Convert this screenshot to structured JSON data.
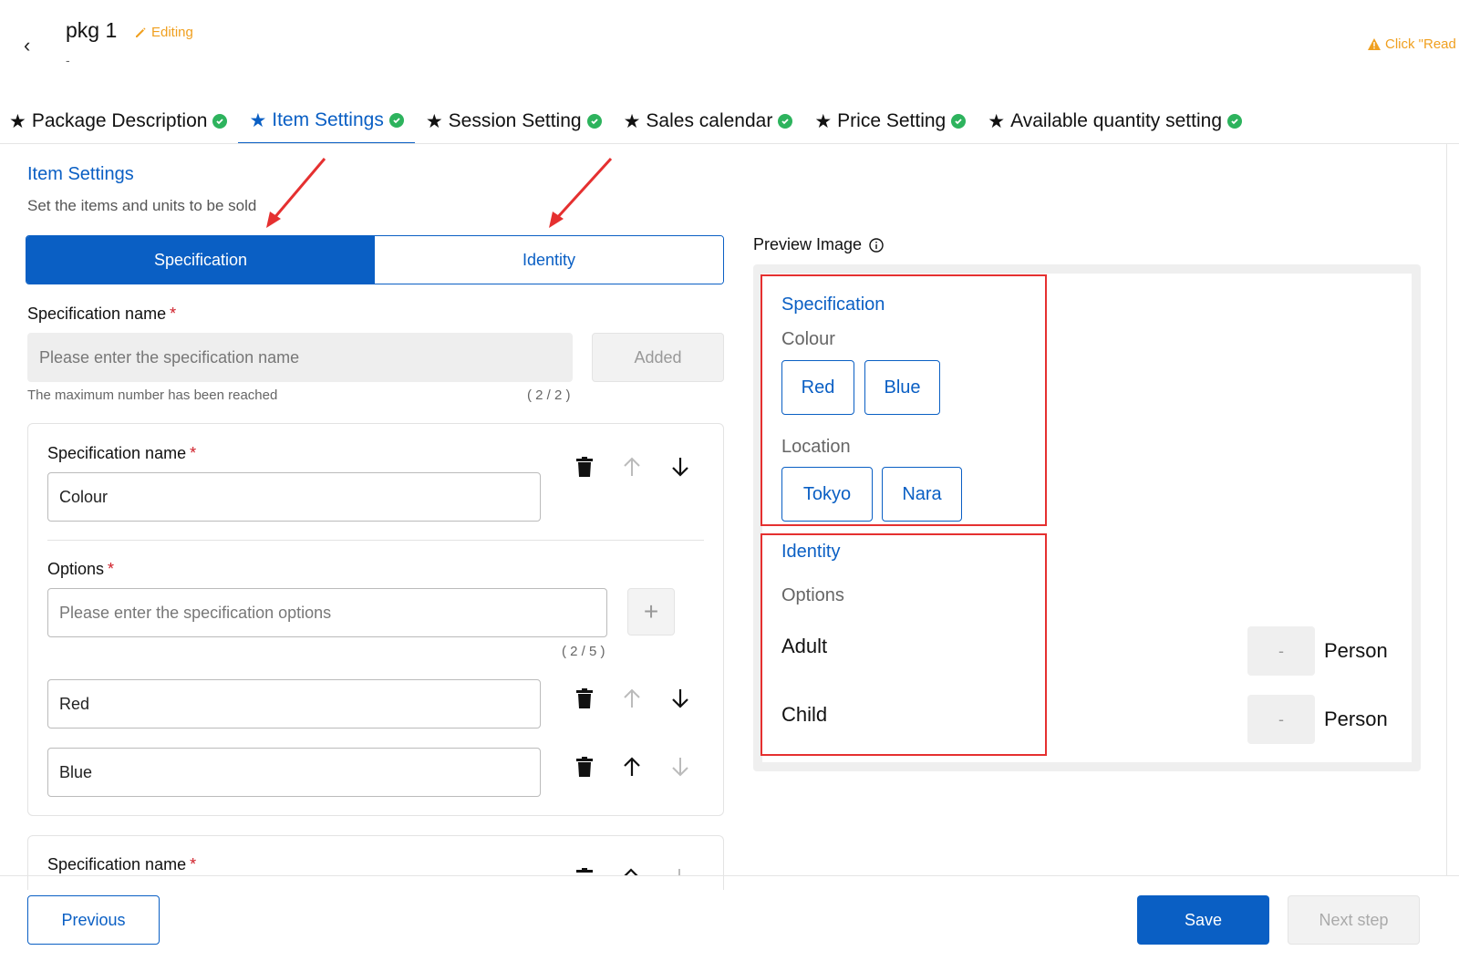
{
  "header": {
    "back_icon": "chevron-left-icon",
    "title": "pkg 1",
    "editing_label": "Editing",
    "subtitle": "-",
    "notice": "Click \"Read"
  },
  "tabs": [
    {
      "label": "Package Description",
      "active": false
    },
    {
      "label": "Item Settings",
      "active": true
    },
    {
      "label": "Session Setting",
      "active": false
    },
    {
      "label": "Sales calendar",
      "active": false
    },
    {
      "label": "Price Setting",
      "active": false
    },
    {
      "label": "Available quantity setting",
      "active": false
    }
  ],
  "tab_star": "★",
  "section": {
    "title": "Item Settings",
    "subtitle": "Set the items and units to be sold"
  },
  "mode_toggle": {
    "specification": "Specification",
    "identity": "Identity",
    "selected": "Specification"
  },
  "add_spec": {
    "label": "Specification name",
    "required_mark": "*",
    "placeholder": "Please enter the specification name",
    "button": "Added",
    "hint": "The maximum number has been reached",
    "count": "( 2 / 2 )"
  },
  "spec_card": {
    "name_label": "Specification name",
    "required_mark": "*",
    "name_value": "Colour",
    "options_label": "Options",
    "options_placeholder": "Please enter the specification options",
    "options_count": "( 2 / 5 )",
    "add_symbol": "+",
    "options": [
      "Red",
      "Blue"
    ]
  },
  "spec_card2": {
    "name_label": "Specification name",
    "required_mark": "*"
  },
  "preview": {
    "label": "Preview Image",
    "specification_title": "Specification",
    "groups": [
      {
        "name": "Colour",
        "chips": [
          "Red",
          "Blue"
        ]
      },
      {
        "name": "Location",
        "chips": [
          "Tokyo",
          "Nara"
        ]
      }
    ],
    "identity_title": "Identity",
    "identity_options_label": "Options",
    "identity_items": [
      {
        "name": "Adult",
        "qty": "-",
        "unit": "Person"
      },
      {
        "name": "Child",
        "qty": "-",
        "unit": "Person"
      }
    ]
  },
  "footer": {
    "previous": "Previous",
    "save": "Save",
    "next": "Next step"
  },
  "colors": {
    "primary": "#0a5fc4",
    "success": "#2db35d",
    "warning": "#f0a020",
    "annotation": "#e53030"
  }
}
